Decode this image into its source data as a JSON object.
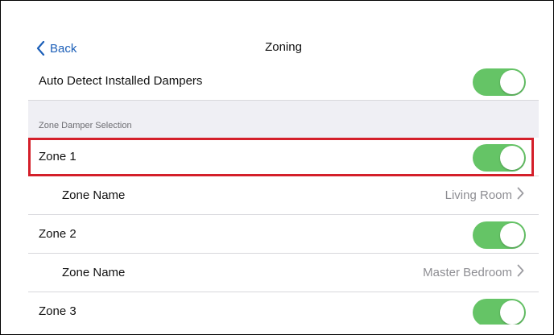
{
  "nav": {
    "back_label": "Back",
    "title": "Zoning"
  },
  "auto_detect": {
    "label": "Auto Detect Installed Dampers",
    "enabled": true
  },
  "section": {
    "label": "Zone Damper Selection"
  },
  "zones": [
    {
      "label": "Zone 1",
      "enabled": true,
      "name_label": "Zone Name",
      "name_value": "Living Room"
    },
    {
      "label": "Zone 2",
      "enabled": true,
      "name_label": "Zone Name",
      "name_value": "Master Bedroom"
    },
    {
      "label": "Zone 3",
      "enabled": true
    }
  ],
  "colors": {
    "accent": "#1c5fb8",
    "toggle_on": "#65c466",
    "highlight": "#d41f2a",
    "section_bg": "#efeff4"
  },
  "icons": {
    "back": "chevron-left-icon",
    "disclosure": "chevron-right-icon"
  }
}
